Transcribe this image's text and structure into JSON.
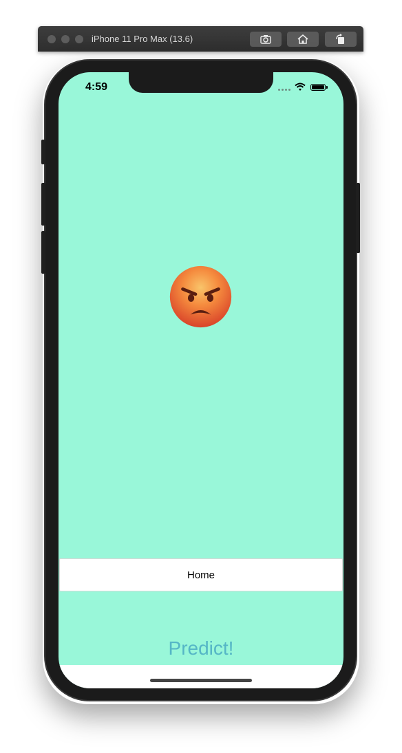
{
  "simulator": {
    "title": "iPhone 11 Pro Max (13.6)",
    "buttons": [
      {
        "icon": "screenshot-icon"
      },
      {
        "icon": "home-icon"
      },
      {
        "icon": "rotate-icon"
      }
    ]
  },
  "status_bar": {
    "time": "4:59",
    "icons": [
      "signal-dots-icon",
      "wifi-icon",
      "battery-icon"
    ]
  },
  "main": {
    "emoji": "pouting-angry-face",
    "background_color": "#99f7d9"
  },
  "nav": {
    "home_label": "Home"
  },
  "actions": {
    "predict_label": "Predict!",
    "predict_color": "#55b6c6"
  }
}
